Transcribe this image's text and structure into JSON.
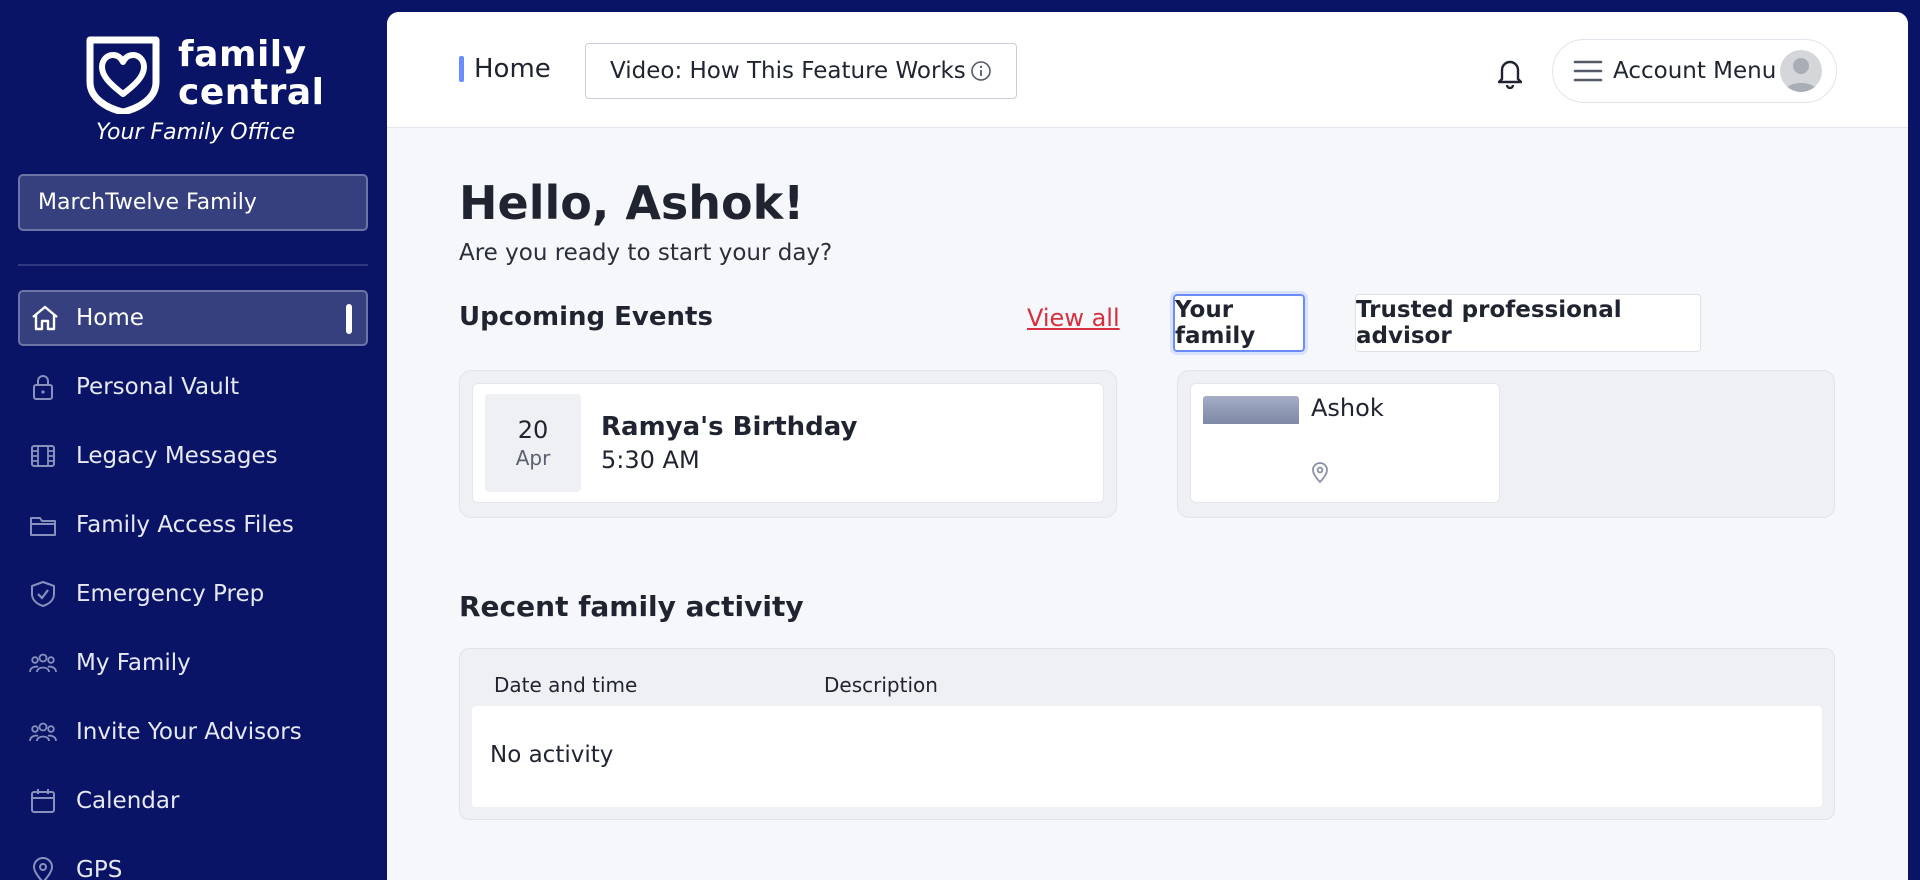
{
  "brand": {
    "line1": "family",
    "line2": "central",
    "tagline": "Your Family Office",
    "colors": {
      "sidebar": "#0a1466",
      "accent": "#6b8cff",
      "link": "#d62f3d",
      "chat": "#1f7ad6"
    }
  },
  "family_selector": {
    "value": "MarchTwelve Family"
  },
  "sidebar": {
    "items": [
      {
        "label": "Home",
        "icon": "home-icon",
        "active": true
      },
      {
        "label": "Personal Vault",
        "icon": "lock-icon"
      },
      {
        "label": "Legacy Messages",
        "icon": "film-icon"
      },
      {
        "label": "Family Access Files",
        "icon": "folder-icon"
      },
      {
        "label": "Emergency Prep",
        "icon": "shield-check-icon"
      },
      {
        "label": "My Family",
        "icon": "people-icon"
      },
      {
        "label": "Invite Your Advisors",
        "icon": "people-icon"
      },
      {
        "label": "Calendar",
        "icon": "calendar-icon"
      },
      {
        "label": "GPS",
        "icon": "location-pin-icon"
      }
    ]
  },
  "header": {
    "breadcrumb": "Home",
    "video_button": "Video: How This Feature Works",
    "account_menu": "Account Menu"
  },
  "greeting": {
    "title": "Hello, Ashok!",
    "subtitle": "Are you ready to start your day?"
  },
  "events": {
    "title": "Upcoming Events",
    "view_all": "View all",
    "items": [
      {
        "day": "20",
        "month": "Apr",
        "name": "Ramya's Birthday",
        "time": "5:30 AM"
      }
    ]
  },
  "family_tabs": {
    "tabs": [
      "Your family",
      "Trusted professional advisor"
    ],
    "selected": "Your family",
    "members": [
      {
        "name": "Ashok"
      }
    ]
  },
  "activity": {
    "title": "Recent family activity",
    "columns": [
      "Date and time",
      "Description"
    ],
    "empty_text": "No activity"
  }
}
